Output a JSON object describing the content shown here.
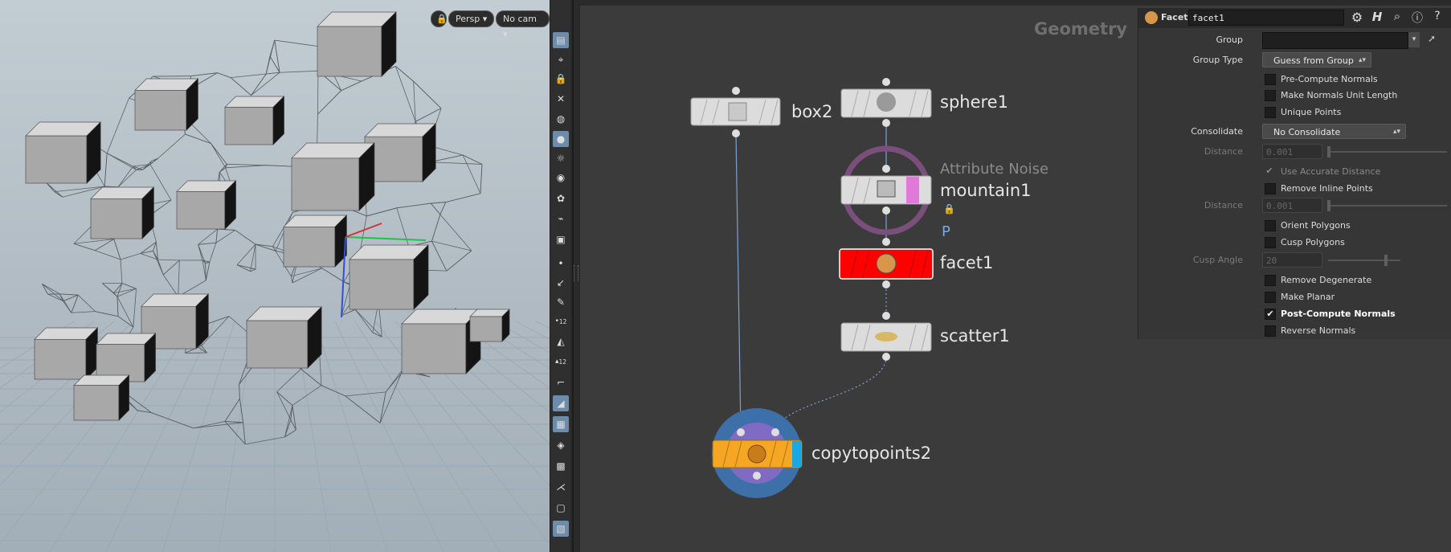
{
  "viewport": {
    "persp_label": "Persp",
    "cam_label": "No cam"
  },
  "toolbar": {
    "icons": [
      "viewport-layout-icon",
      "snap-icon",
      "lock-icon",
      "ghost-icon",
      "wireframe-icon",
      "light-icon",
      "headlight-icon",
      "point-light-icon",
      "display-options-icon",
      "camera-icon",
      "object-icon",
      "point-icon",
      "vector-icon",
      "probe-icon",
      "point-number-icon",
      "texture-icon",
      "primitive-number-icon",
      "ruler-icon",
      "shading-icon",
      "checker-icon",
      "layers-icon",
      "frame-icon",
      "shape-icon",
      "stage-icon",
      "snapshot-icon"
    ],
    "point_number_label": "12",
    "prim_number_label": "12"
  },
  "network": {
    "title": "Geometry",
    "nodes": [
      {
        "id": "box2",
        "label": "box2"
      },
      {
        "id": "sphere1",
        "label": "sphere1"
      },
      {
        "id": "mountain1",
        "label": "mountain1",
        "type_label": "Attribute Noise",
        "flag": "P"
      },
      {
        "id": "facet1",
        "label": "facet1"
      },
      {
        "id": "scatter1",
        "label": "scatter1"
      },
      {
        "id": "copytopoints2",
        "label": "copytopoints2"
      }
    ],
    "colors": {
      "selected": "#ff0000",
      "copy": "#f5a623",
      "ring": "#3d6fa8",
      "noise_ring": "#7a4f7c"
    }
  },
  "params": {
    "node_type": "Facet",
    "node_name": "facet1",
    "group_label": "Group",
    "group_value": "",
    "group_type_label": "Group Type",
    "group_type_value": "Guess from Group",
    "pre_compute_normals": "Pre-Compute Normals",
    "make_normals_unit": "Make Normals Unit Length",
    "unique_points": "Unique Points",
    "consolidate_label": "Consolidate",
    "consolidate_value": "No Consolidate",
    "distance_label": "Distance",
    "distance_value": "0.001",
    "use_accurate_distance": "Use Accurate Distance",
    "remove_inline_points": "Remove Inline Points",
    "distance2_label": "Distance",
    "distance2_value": "0.001",
    "orient_polygons": "Orient Polygons",
    "cusp_polygons": "Cusp Polygons",
    "cusp_angle_label": "Cusp Angle",
    "cusp_angle_value": "20",
    "remove_degenerate": "Remove Degenerate",
    "make_planar": "Make Planar",
    "post_compute_normals": "Post-Compute Normals",
    "reverse_normals": "Reverse Normals",
    "check_mark": "✔"
  }
}
